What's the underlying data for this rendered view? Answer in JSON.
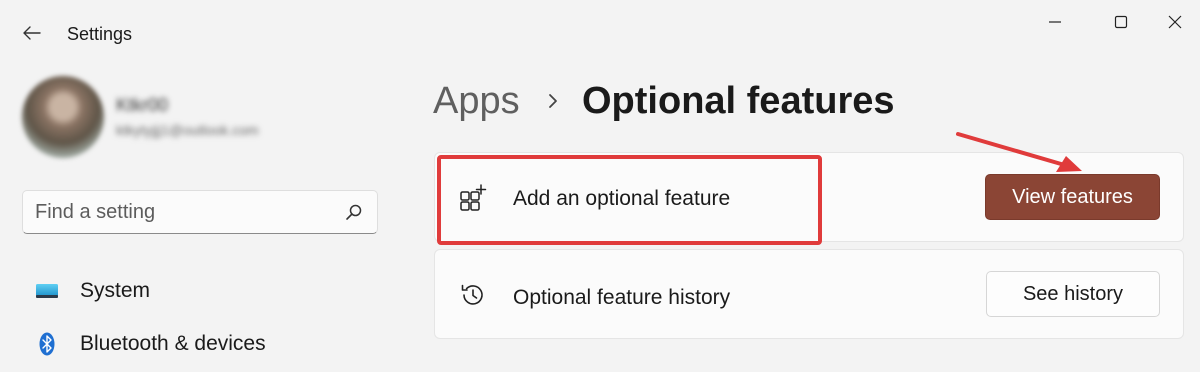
{
  "titlebar": {
    "app_title": "Settings"
  },
  "profile": {
    "name": "Ktkr00",
    "email": "ktkytyjjj1@outlook.com"
  },
  "search": {
    "placeholder": "Find a setting"
  },
  "nav": {
    "items": [
      {
        "label": "System",
        "icon": "monitor-icon"
      },
      {
        "label": "Bluetooth & devices",
        "icon": "bluetooth-icon"
      }
    ]
  },
  "breadcrumb": {
    "parent": "Apps",
    "current": "Optional features"
  },
  "cards": {
    "add": {
      "label": "Add an optional feature",
      "icon": "add-app-icon",
      "button": "View features"
    },
    "history": {
      "label": "Optional feature history",
      "icon": "history-icon",
      "button": "See history"
    }
  },
  "colors": {
    "accent": "#8b4535",
    "annotation": "#e03b3b",
    "background": "#f3f3f3"
  }
}
